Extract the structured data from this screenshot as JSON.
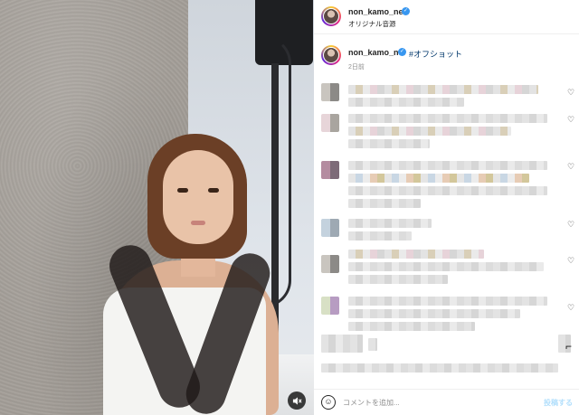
{
  "post": {
    "author": "non_kamo_ne",
    "audio_label": "オリジナル音源",
    "verified_glyph": "✓"
  },
  "caption": {
    "author": "non_kamo_ne",
    "hashtag": "#オフショット",
    "time": "2日前"
  },
  "icons": {
    "mute": "speaker-muted-icon",
    "heart": "♡",
    "emoji": "☺",
    "cursor": "⌐"
  },
  "comment_box": {
    "placeholder": "コメントを追加...",
    "post_label": "投稿する"
  }
}
